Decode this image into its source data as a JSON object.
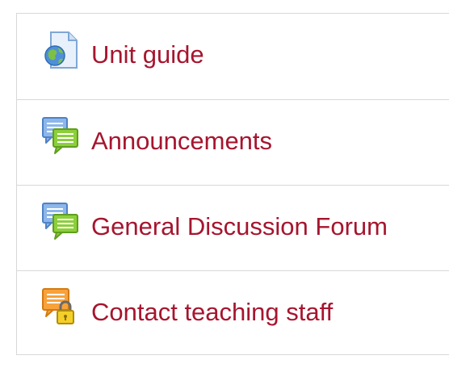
{
  "activities": [
    {
      "label": "Unit guide",
      "icon": "url-globe-icon",
      "type": "url"
    },
    {
      "label": "Announcements",
      "icon": "forum-icon",
      "type": "forum"
    },
    {
      "label": "General Discussion Forum",
      "icon": "forum-icon",
      "type": "forum"
    },
    {
      "label": "Contact teaching staff",
      "icon": "locked-forum-icon",
      "type": "forum"
    }
  ],
  "colors": {
    "link": "#a6152e",
    "divider": "#d8d8d8"
  }
}
